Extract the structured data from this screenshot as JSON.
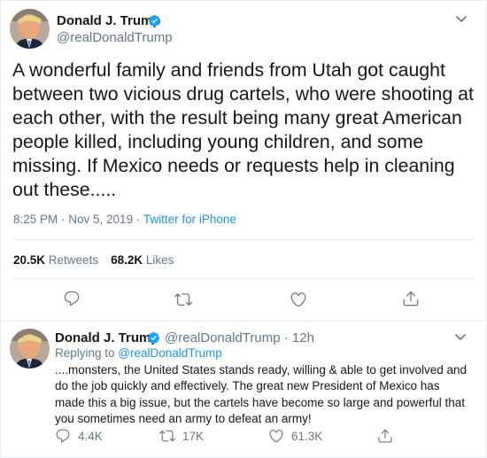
{
  "main_tweet": {
    "author_name": "Donald J. Trump",
    "handle": "@realDonaldTrump",
    "text": "A wonderful family and friends from Utah got caught between two vicious drug cartels, who were shooting at each other, with the result being many great American people killed, including young children, and some missing. If Mexico needs or requests help in cleaning out these.....",
    "time": "8:25 PM · Nov 5, 2019 · ",
    "source": "Twitter for iPhone",
    "retweets_count": "20.5K",
    "retweets_label": "Retweets",
    "likes_count": "68.2K",
    "likes_label": "Likes",
    "actions": [
      "reply-icon",
      "retweet-icon",
      "like-icon",
      "share-icon"
    ]
  },
  "reply_tweet": {
    "author_name": "Donald J. Trump",
    "handle_time": "@realDonaldTrump · 12h",
    "replying_prefix": "Replying to ",
    "replying_mention": "@realDonaldTrump",
    "text": "....monsters, the United States stands ready, willing & able to get involved and do the job quickly and effectively. The great new President of Mexico has made this a big issue, but the cartels have become so large and powerful that you sometimes need an army to defeat an army!",
    "reply_count": "4.4K",
    "retweet_count": "17K",
    "like_count": "61.3K"
  },
  "colors": {
    "text": "#14171a",
    "secondary": "#657786",
    "link": "#1b95e0",
    "verified": "#1da1f2",
    "divider": "#e6ecf0"
  }
}
